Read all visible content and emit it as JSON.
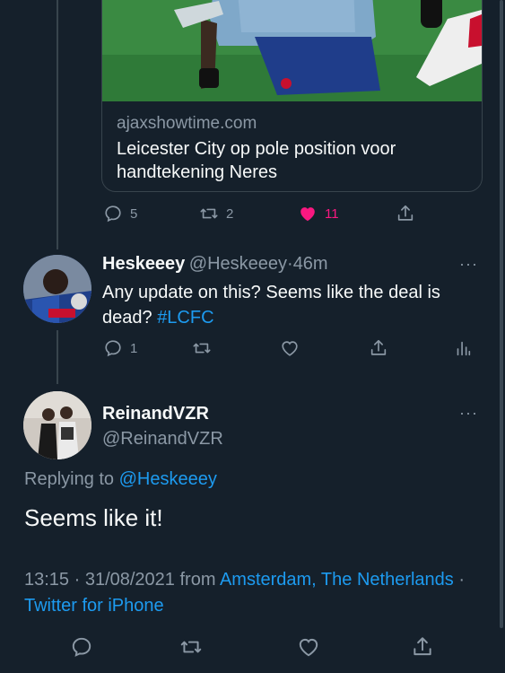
{
  "tweet1": {
    "card_domain": "ajaxshowtime.com",
    "card_title": "Leicester City op pole position voor handtekening Neres",
    "replies": "5",
    "retweets": "2",
    "likes": "11"
  },
  "tweet2": {
    "name": "Heskeeey",
    "handle": "@Heskeeey",
    "sep": "·",
    "time": "46m",
    "text": "Any update on this? Seems like the deal is dead?",
    "hashtag": "#LCFC",
    "replies": "1",
    "more": "···"
  },
  "tweet3": {
    "name": "ReinandVZR",
    "handle": "@ReinandVZR",
    "more": "···",
    "replying_prefix": "Replying to",
    "replying_handle": "@Heskeeey",
    "text": "Seems like it!",
    "time": "13:15 · 31/08/2021 from",
    "location": "Amsterdam, The Netherlands",
    "sep": "·",
    "client": "Twitter for iPhone"
  },
  "colors": {
    "background": "#15202b",
    "accent": "#1d9bf0",
    "like": "#f91880",
    "secondary": "#8b98a5"
  }
}
